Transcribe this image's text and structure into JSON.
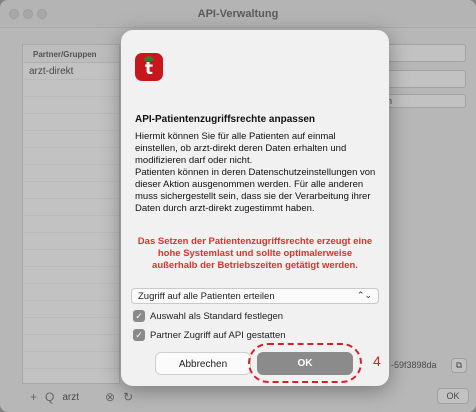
{
  "window": {
    "title": "API-Verwaltung"
  },
  "sidebar": {
    "header": "Partner/Gruppen",
    "items": [
      "arzt-direkt"
    ]
  },
  "bottom_bar": {
    "add_icon": "+",
    "search_icon": "Q",
    "search_value": "arzt",
    "clear_icon": "⊗",
    "refresh_icon": "↻"
  },
  "background": {
    "field_fragment": "n",
    "key_fragment": "-59f3898da",
    "copy_icon": "⧉",
    "ok_label": "OK"
  },
  "dialog": {
    "app_icon_letter": "t",
    "title": "API-Patientenzugriffsrechte anpassen",
    "body": "Hiermit können Sie für alle Patienten auf einmal einstellen, ob arzt-direkt deren Daten erhalten und modifizieren darf oder nicht.\nPatienten können in deren Datenschutzeinstellungen von dieser Aktion ausgenommen werden. Für alle anderen muss sichergestellt sein, dass sie der Verarbeitung ihrer Daten durch arzt-direkt zugestimmt haben.",
    "warning": "Das Setzen der Patientenzugriffsrechte erzeugt eine hohe Systemlast und sollte optimalerweise außerhalb der Betriebszeiten getätigt werden.",
    "select_value": "Zugriff auf alle Patienten erteilen",
    "select_arrow": "⌃⌄",
    "checkbox_default": "Auswahl als Standard festlegen",
    "checkbox_api": "Partner Zugriff auf API gestatten",
    "check_mark": "✓",
    "cancel_label": "Abbrechen",
    "ok_label": "OK"
  },
  "annotation": {
    "marker": "4"
  },
  "colors": {
    "warning": "#e0312b",
    "highlight": "#d7202a",
    "brand": "#c8161d"
  }
}
